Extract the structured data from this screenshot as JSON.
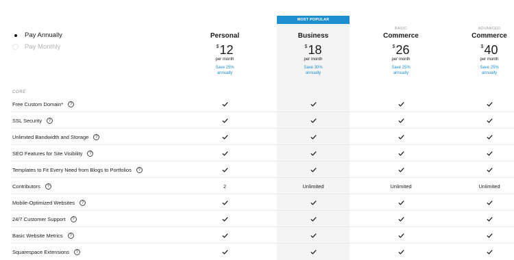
{
  "banner": {
    "most_popular": "MOST POPULAR"
  },
  "billing": {
    "annually": "Pay Annually",
    "monthly": "Pay Monthly",
    "selected": "annually"
  },
  "plans": [
    {
      "sub": "",
      "name": "Personal",
      "currency": "$",
      "price": "12",
      "per": "per month",
      "save1": "Save 25%",
      "save2": "annually"
    },
    {
      "sub": "",
      "name": "Business",
      "currency": "$",
      "price": "18",
      "per": "per month",
      "save1": "Save 30%",
      "save2": "annually"
    },
    {
      "sub": "BASIC",
      "name": "Commerce",
      "currency": "$",
      "price": "26",
      "per": "per month",
      "save1": "Save 25%",
      "save2": "annually"
    },
    {
      "sub": "ADVANCED",
      "name": "Commerce",
      "currency": "$",
      "price": "40",
      "per": "per month",
      "save1": "Save 25%",
      "save2": "annually"
    }
  ],
  "section_label": "CORE",
  "help_glyph": "?",
  "features": [
    {
      "label": "Free Custom Domain*",
      "values": [
        "check",
        "check",
        "check",
        "check"
      ]
    },
    {
      "label": "SSL Security",
      "values": [
        "check",
        "check",
        "check",
        "check"
      ]
    },
    {
      "label": "Unlimited Bandwidth and Storage",
      "values": [
        "check",
        "check",
        "check",
        "check"
      ]
    },
    {
      "label": "SEO Features for Site Visibility",
      "values": [
        "check",
        "check",
        "check",
        "check"
      ]
    },
    {
      "label": "Templates to Fit Every Need from Blogs to Portfolios",
      "values": [
        "check",
        "check",
        "check",
        "check"
      ]
    },
    {
      "label": "Contributors",
      "values": [
        "2",
        "Unlimited",
        "Unlimited",
        "Unlimited"
      ]
    },
    {
      "label": "Mobile-Optimized Websites",
      "values": [
        "check",
        "check",
        "check",
        "check"
      ]
    },
    {
      "label": "24/7 Customer Support",
      "values": [
        "check",
        "check",
        "check",
        "check"
      ]
    },
    {
      "label": "Basic Website Metrics",
      "values": [
        "check",
        "check",
        "check",
        "check"
      ]
    },
    {
      "label": "Squarespace Extensions",
      "values": [
        "check",
        "check",
        "check",
        "check"
      ]
    }
  ],
  "colors": {
    "accent": "#1d8ecf",
    "highlight_column": "#f4f4f4"
  },
  "icons": {
    "check": "check-icon",
    "help": "question-circle-icon"
  }
}
